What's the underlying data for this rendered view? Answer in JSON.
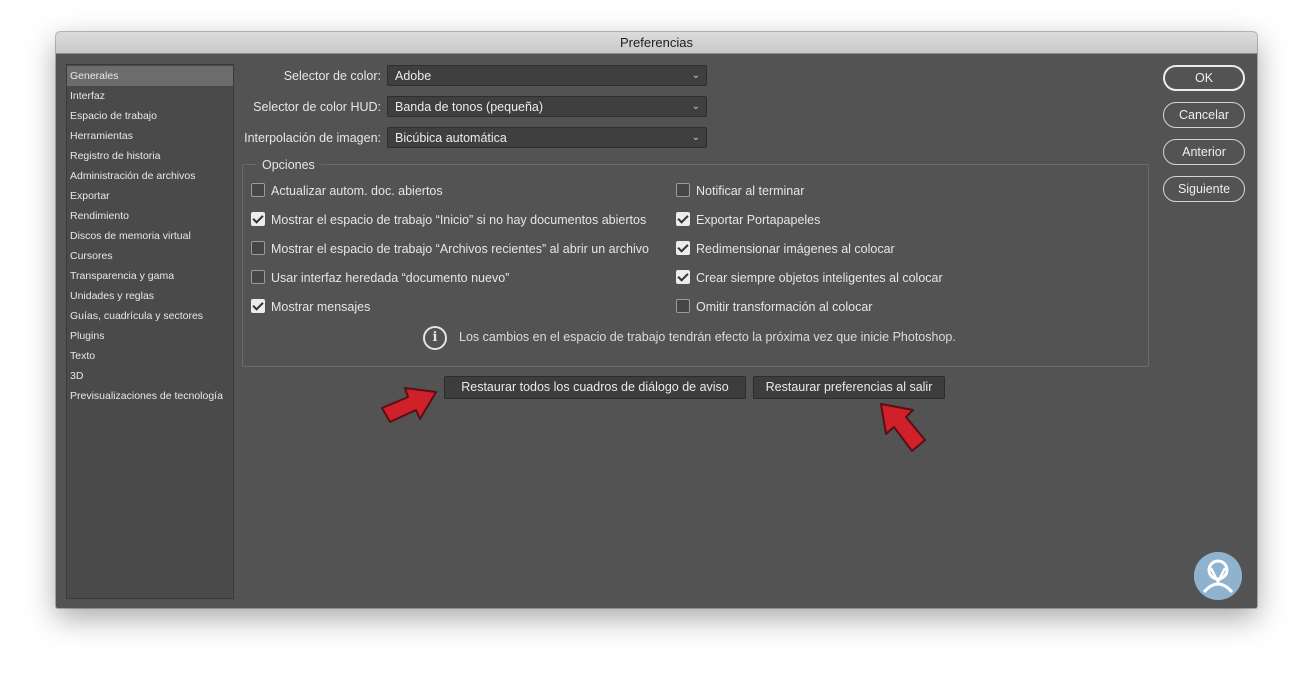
{
  "window": {
    "title": "Preferencias"
  },
  "sidebar": {
    "items": [
      {
        "label": "Generales",
        "active": true
      },
      {
        "label": "Interfaz"
      },
      {
        "label": "Espacio de trabajo"
      },
      {
        "label": "Herramientas"
      },
      {
        "label": "Registro de historia"
      },
      {
        "label": "Administración de archivos"
      },
      {
        "label": "Exportar"
      },
      {
        "label": "Rendimiento"
      },
      {
        "label": "Discos de memoria virtual"
      },
      {
        "label": "Cursores"
      },
      {
        "label": "Transparencia y gama"
      },
      {
        "label": "Unidades y reglas"
      },
      {
        "label": "Guías, cuadrícula y sectores"
      },
      {
        "label": "Plugins"
      },
      {
        "label": "Texto"
      },
      {
        "label": "3D"
      },
      {
        "label": "Previsualizaciones de tecnología"
      }
    ]
  },
  "form": {
    "color_picker": {
      "label": "Selector de color:",
      "value": "Adobe"
    },
    "hud_color_picker": {
      "label": "Selector de color HUD:",
      "value": "Banda de tonos (pequeña)"
    },
    "image_interpolation": {
      "label": "Interpolación de imagen:",
      "value": "Bicúbica automática"
    }
  },
  "options": {
    "title": "Opciones",
    "left": [
      {
        "label": "Actualizar autom. doc. abiertos",
        "checked": false
      },
      {
        "label": "Mostrar el espacio de trabajo “Inicio” si no hay documentos abiertos",
        "checked": true
      },
      {
        "label": "Mostrar el espacio de trabajo “Archivos recientes” al abrir un archivo",
        "checked": false
      },
      {
        "label": "Usar interfaz heredada “documento nuevo”",
        "checked": false
      },
      {
        "label": "Mostrar mensajes",
        "checked": true
      }
    ],
    "right": [
      {
        "label": "Notificar al terminar",
        "checked": false
      },
      {
        "label": "Exportar Portapapeles",
        "checked": true
      },
      {
        "label": "Redimensionar imágenes al colocar",
        "checked": true
      },
      {
        "label": "Crear siempre objetos inteligentes al colocar",
        "checked": true
      },
      {
        "label": "Omitir transformación al colocar",
        "checked": false
      }
    ],
    "note": "Los cambios en el espacio de trabajo tendrán efecto la próxima vez que inicie Photoshop."
  },
  "buttons": {
    "reset_dialogs": "Restaurar todos los cuadros de diálogo de aviso",
    "reset_prefs": "Restaurar preferencias al salir",
    "ok": "OK",
    "cancel": "Cancelar",
    "previous": "Anterior",
    "next": "Siguiente"
  },
  "colors": {
    "panel": "#535353",
    "annotation_arrow": "#d0202a",
    "logo": "#8fb3cf"
  },
  "icons": {
    "info": "info-icon",
    "chevron": "chevron-down-icon",
    "arrow": "red-arrow-icon"
  }
}
